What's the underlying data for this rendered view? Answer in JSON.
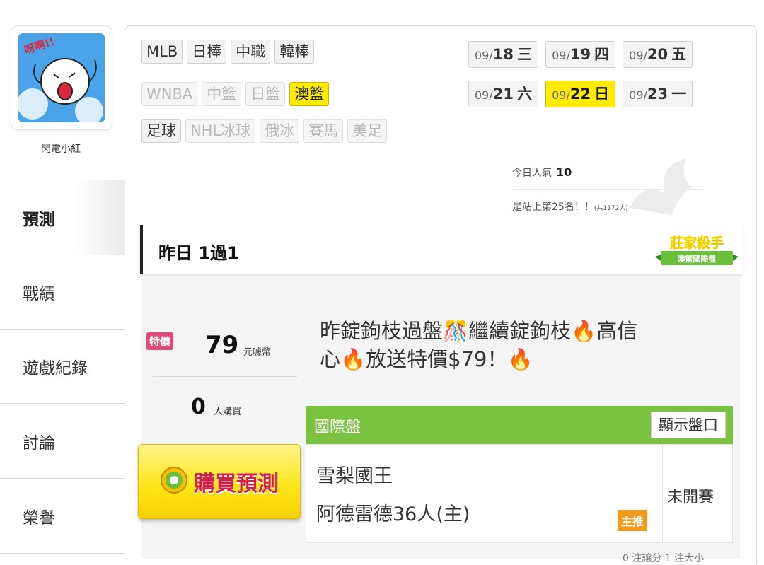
{
  "user": {
    "name": "閃電小紅"
  },
  "sidebar": {
    "items": [
      {
        "label": "預測"
      },
      {
        "label": "戰績"
      },
      {
        "label": "遊戲紀錄"
      },
      {
        "label": "討論"
      },
      {
        "label": "榮譽"
      }
    ]
  },
  "leagues": {
    "row1": [
      "MLB",
      "日棒",
      "中職",
      "韓棒"
    ],
    "row2": [
      "WNBA",
      "中籃",
      "日籃",
      "澳籃"
    ],
    "row3": [
      "足球",
      "NHL冰球",
      "俄冰",
      "賽馬",
      "美足"
    ],
    "active": "澳籃",
    "disabled": [
      "WNBA",
      "中籃",
      "日籃",
      "NHL冰球",
      "俄冰",
      "賽馬",
      "美足"
    ]
  },
  "dates": {
    "row1": [
      {
        "md": "09/",
        "d": "18",
        "wd": "三"
      },
      {
        "md": "09/",
        "d": "19",
        "wd": "四"
      },
      {
        "md": "09/",
        "d": "20",
        "wd": "五"
      }
    ],
    "row2": [
      {
        "md": "09/",
        "d": "21",
        "wd": "六"
      },
      {
        "md": "09/",
        "d": "22",
        "wd": "日"
      },
      {
        "md": "09/",
        "d": "23",
        "wd": "一"
      }
    ],
    "active": "22"
  },
  "popularity": {
    "label": "今日人氣",
    "value": "10",
    "rank_text": "是站上第25名！！",
    "total_text": "(共1172人)"
  },
  "yesterday": {
    "text": "昨日 1過1"
  },
  "badge": {
    "title": "莊家殺手",
    "subtitle": "澳籃國際盤"
  },
  "price": {
    "tag": "特價",
    "value": "79",
    "unit": "元噱幣",
    "buyers": "0",
    "buyers_label": "人購買",
    "buy_button": "購買預測"
  },
  "description": {
    "line1_a": "昨錠鉤枝過盤",
    "line1_b": "繼續錠鉤枝",
    "line1_c": "高信",
    "line2_a": "心",
    "line2_b": "放送特價$79！"
  },
  "panel": {
    "title": "國際盤",
    "show_button": "顯示盤口",
    "team_a": "雪梨國王",
    "team_b": "阿德雷德36人(主)",
    "tag": "主推",
    "status": "未開賽"
  },
  "footer_text": "0 注讓分  1 注大小"
}
